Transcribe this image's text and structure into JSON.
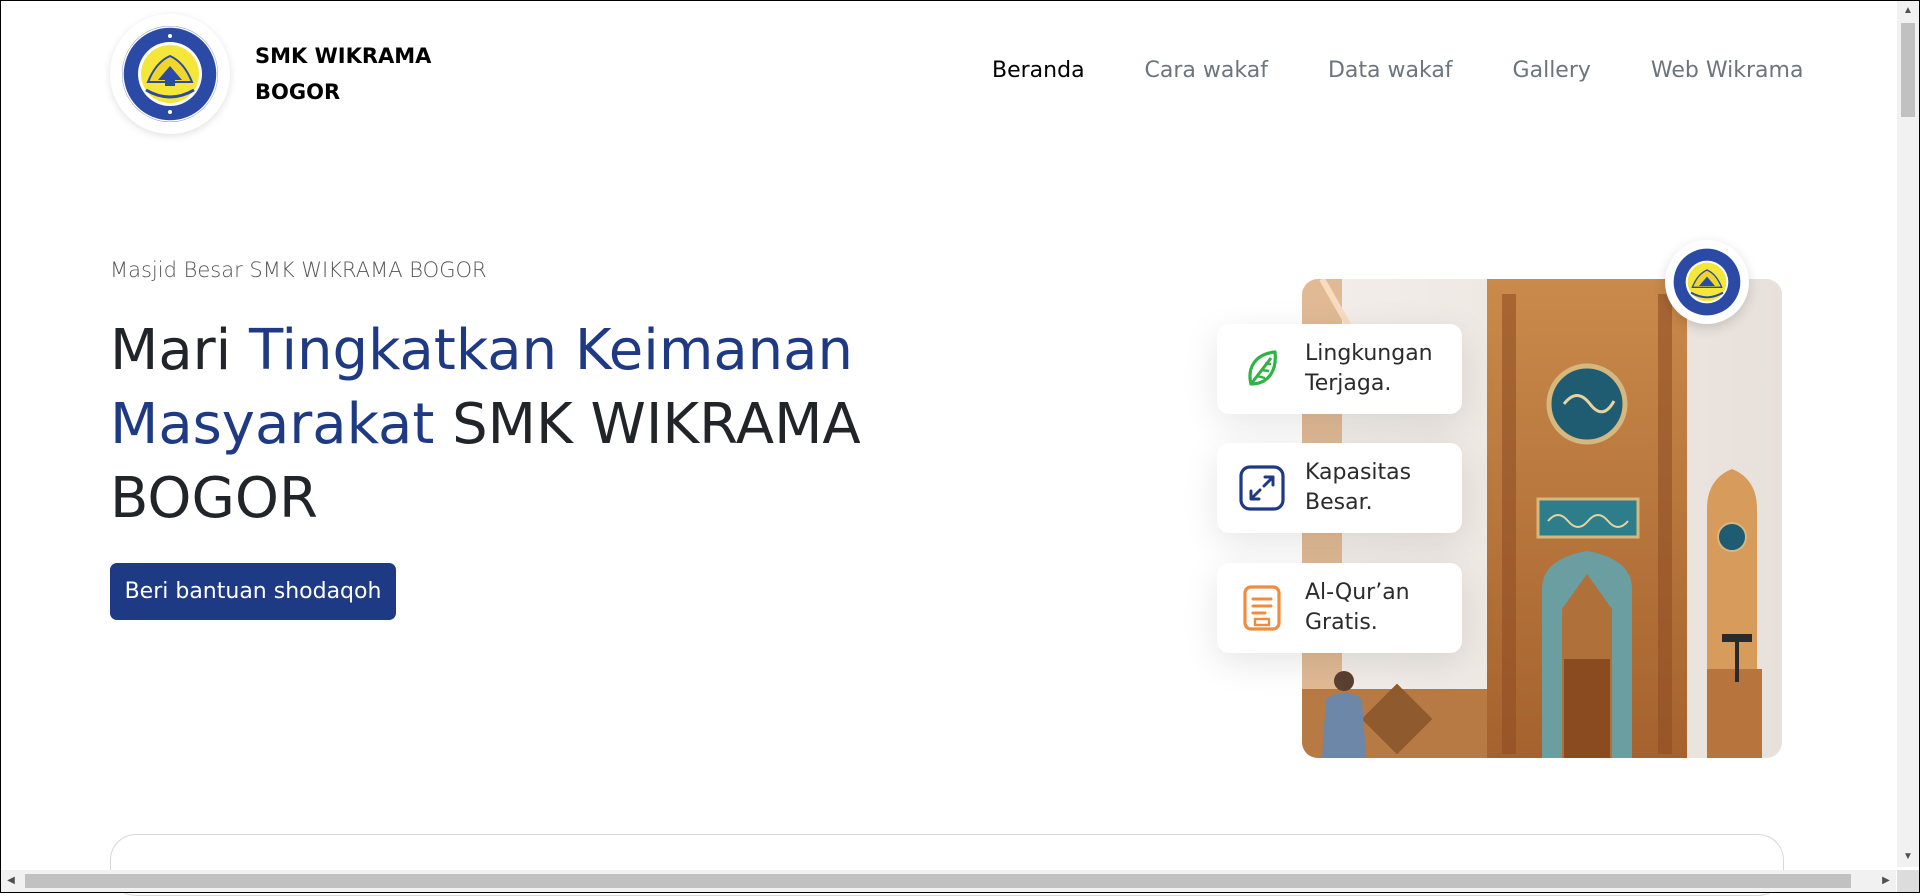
{
  "header": {
    "brand_line1": "SMK WIKRAMA",
    "brand_line2": "BOGOR",
    "logo_icon": "school-logo-icon"
  },
  "nav": {
    "items": [
      {
        "label": "Beranda",
        "active": true
      },
      {
        "label": "Cara wakaf",
        "active": false
      },
      {
        "label": "Data wakaf",
        "active": false
      },
      {
        "label": "Gallery",
        "active": false
      },
      {
        "label": "Web Wikrama",
        "active": false
      }
    ]
  },
  "hero": {
    "eyebrow": "Masjid Besar SMK WIKRAMA BOGOR",
    "headline_part1": "Mari ",
    "headline_accent": "Tingkatkan Keimanan Masyarakat",
    "headline_part2": " SMK WIKRAMA BOGOR",
    "cta_label": "Beri bantuan shodaqoh"
  },
  "features": [
    {
      "line1": "Lingkungan",
      "line2": "Terjaga.",
      "icon": "leaf-icon",
      "color": "#2fb344"
    },
    {
      "line1": "Kapasitas",
      "line2": "Besar.",
      "icon": "expand-icon",
      "color": "#1f3a84"
    },
    {
      "line1": "Al-Qur’an",
      "line2": "Gratis.",
      "icon": "book-icon",
      "color": "#f08c3e"
    }
  ],
  "colors": {
    "primary": "#1e3a85",
    "accent_text": "#1f3a84",
    "nav_inactive": "#6c757d"
  }
}
